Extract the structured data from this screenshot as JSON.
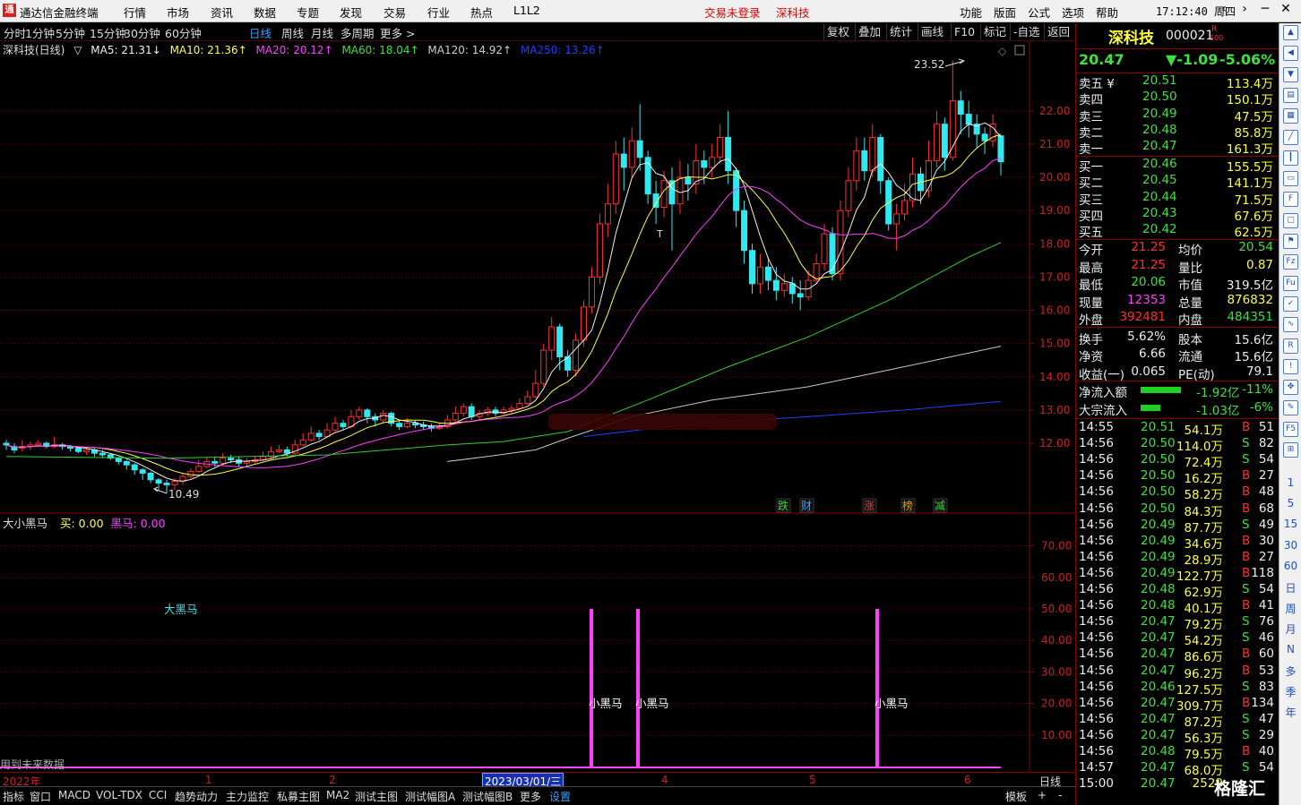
{
  "app": {
    "title": "通达信金融终端",
    "logo": "通"
  },
  "menu": {
    "items": [
      "行情",
      "市场",
      "资讯",
      "数据",
      "专题",
      "发现",
      "交易",
      "行业",
      "热点",
      "L1L2"
    ],
    "status_login": "交易未登录",
    "stock_name": "深科技",
    "right_items": [
      "功能",
      "版面",
      "公式",
      "选项",
      "帮助"
    ],
    "time": "17:12:40",
    "weekday": "周四"
  },
  "period_tabs": [
    "分时",
    "1分钟",
    "5分钟",
    "15分钟",
    "30分钟",
    "60分钟",
    "日线",
    "周线",
    "月线",
    "多周期",
    "更多 >"
  ],
  "active_period": "日线",
  "chart_tools": [
    "复权",
    "叠加",
    "统计",
    "画线",
    "F10",
    "标记",
    "-自选",
    "返回"
  ],
  "main_legend": {
    "title": "深科技(日线)",
    "ma5": "MA5: 21.31↓",
    "ma10": "MA10: 21.36↑",
    "ma20": "MA20: 20.12↑",
    "ma60": "MA60: 18.04↑",
    "ma120": "MA120: 14.92↑",
    "ma250": "MA250: 13.26↑"
  },
  "main_axis_ticks": [
    "22.00",
    "21.00",
    "20.00",
    "19.00",
    "18.00",
    "17.00",
    "16.00",
    "15.00",
    "14.00",
    "13.00",
    "12.00"
  ],
  "price_annotations": {
    "high": "23.52",
    "low": "10.49",
    "t_mark": "T"
  },
  "event_markers": [
    {
      "text": "跌",
      "color": "#40d040"
    },
    {
      "text": "财",
      "color": "#3aa0ff"
    },
    {
      "text": "涨",
      "color": "#ff3030"
    },
    {
      "text": "榜",
      "color": "#e0a000"
    },
    {
      "text": "减",
      "color": "#40d040"
    }
  ],
  "sub_legend": {
    "name": "大小黑马",
    "buy": "买: 0.00",
    "heima": "黑马: 0.00"
  },
  "sub_axis_ticks": [
    "70.00",
    "60.00",
    "50.00",
    "40.00",
    "30.00",
    "20.00",
    "10.00"
  ],
  "sub_labels": {
    "big": "大黑马",
    "small": "小黑马",
    "future": "用到未来数据"
  },
  "sub_signals": [
    {
      "label": "小黑马",
      "value": 50
    },
    {
      "label": "小黑马",
      "value": 50
    },
    {
      "label": "小黑马",
      "value": 50
    }
  ],
  "date_axis": {
    "year": "2022年",
    "months": [
      "1",
      "2",
      "4",
      "5",
      "6"
    ],
    "selected": "2023/03/01/三",
    "period": "日线"
  },
  "bottom_tabs": [
    "指标",
    "窗口",
    "MACD",
    "VOL-TDX",
    "CCI",
    "趋势动力",
    "主力监控",
    "私募主图",
    "MA2",
    "测试主图",
    "测试幅图A",
    "测试幅图B",
    "更多",
    "设置"
  ],
  "bottom_right": [
    "模板",
    "+",
    "-"
  ],
  "quote": {
    "name": "深科技",
    "code": "000021",
    "tag_r": "R",
    "tag_500": "500",
    "price": "20.47",
    "change": "▼-1.09",
    "pct": "-5.06%",
    "asks": [
      {
        "label": "卖五 ¥",
        "price": "20.51",
        "vol": "113.4万"
      },
      {
        "label": "卖四",
        "price": "20.50",
        "vol": "150.1万"
      },
      {
        "label": "卖三",
        "price": "20.49",
        "vol": "47.5万"
      },
      {
        "label": "卖二",
        "price": "20.48",
        "vol": "85.8万"
      },
      {
        "label": "卖一",
        "price": "20.47",
        "vol": "161.3万"
      }
    ],
    "bids": [
      {
        "label": "买一",
        "price": "20.46",
        "vol": "155.5万"
      },
      {
        "label": "买二",
        "price": "20.45",
        "vol": "141.1万"
      },
      {
        "label": "买三",
        "price": "20.44",
        "vol": "71.5万"
      },
      {
        "label": "买四",
        "price": "20.43",
        "vol": "67.6万"
      },
      {
        "label": "买五",
        "price": "20.42",
        "vol": "62.5万"
      }
    ],
    "stats": [
      {
        "l1": "今开",
        "v1": "21.25",
        "l2": "均价",
        "v2": "20.54"
      },
      {
        "l1": "最高",
        "v1": "21.25",
        "l2": "量比",
        "v2": "0.87"
      },
      {
        "l1": "最低",
        "v1": "20.06",
        "l2": "市值",
        "v2": "319.5亿"
      },
      {
        "l1": "现量",
        "v1": "12353",
        "l2": "总量",
        "v2": "876832"
      },
      {
        "l1": "外盘",
        "v1": "392481",
        "l2": "内盘",
        "v2": "484351"
      },
      {
        "l1": "换手",
        "v1": "5.62%",
        "l2": "股本",
        "v2": "15.6亿"
      },
      {
        "l1": "净资",
        "v1": "6.66",
        "l2": "流通",
        "v2": "15.6亿"
      },
      {
        "l1": "收益(一)",
        "v1": "0.065",
        "l2": "PE(动)",
        "v2": "79.1"
      }
    ],
    "flows": [
      {
        "label": "净流入额",
        "value": "-1.92亿",
        "pct": "-11%"
      },
      {
        "label": "大宗流入",
        "value": "-1.03亿",
        "pct": "-6%"
      }
    ],
    "ticks": [
      {
        "t": "14:55",
        "p": "20.51",
        "v": "54.1万",
        "s": "B",
        "n": "51"
      },
      {
        "t": "14:56",
        "p": "20.50",
        "v": "114.0万",
        "s": "S",
        "n": "82"
      },
      {
        "t": "14:56",
        "p": "20.50",
        "v": "72.4万",
        "s": "S",
        "n": "54"
      },
      {
        "t": "14:56",
        "p": "20.50",
        "v": "16.2万",
        "s": "B",
        "n": "27"
      },
      {
        "t": "14:56",
        "p": "20.50",
        "v": "58.2万",
        "s": "B",
        "n": "48"
      },
      {
        "t": "14:56",
        "p": "20.50",
        "v": "84.3万",
        "s": "B",
        "n": "68"
      },
      {
        "t": "14:56",
        "p": "20.49",
        "v": "87.7万",
        "s": "S",
        "n": "49"
      },
      {
        "t": "14:56",
        "p": "20.49",
        "v": "34.6万",
        "s": "B",
        "n": "30"
      },
      {
        "t": "14:56",
        "p": "20.49",
        "v": "28.9万",
        "s": "B",
        "n": "27"
      },
      {
        "t": "14:56",
        "p": "20.49",
        "v": "122.7万",
        "s": "B",
        "n": "118"
      },
      {
        "t": "14:56",
        "p": "20.48",
        "v": "62.9万",
        "s": "S",
        "n": "54"
      },
      {
        "t": "14:56",
        "p": "20.48",
        "v": "40.1万",
        "s": "B",
        "n": "41"
      },
      {
        "t": "14:56",
        "p": "20.47",
        "v": "79.2万",
        "s": "S",
        "n": "76"
      },
      {
        "t": "14:56",
        "p": "20.47",
        "v": "54.2万",
        "s": "S",
        "n": "46"
      },
      {
        "t": "14:56",
        "p": "20.47",
        "v": "86.6万",
        "s": "B",
        "n": "60"
      },
      {
        "t": "14:56",
        "p": "20.47",
        "v": "96.2万",
        "s": "B",
        "n": "53"
      },
      {
        "t": "14:56",
        "p": "20.46",
        "v": "127.5万",
        "s": "S",
        "n": "83"
      },
      {
        "t": "14:56",
        "p": "20.47",
        "v": "309.7万",
        "s": "B",
        "n": "134"
      },
      {
        "t": "14:56",
        "p": "20.47",
        "v": "87.2万",
        "s": "S",
        "n": "47"
      },
      {
        "t": "14:56",
        "p": "20.47",
        "v": "56.3万",
        "s": "S",
        "n": "29"
      },
      {
        "t": "14:56",
        "p": "20.48",
        "v": "79.5万",
        "s": "B",
        "n": "40"
      },
      {
        "t": "14:57",
        "p": "20.47",
        "v": "68.0万",
        "s": "S",
        "n": "54"
      },
      {
        "t": "15:00",
        "p": "20.47",
        "v": "2529",
        "s": "",
        "n": ""
      }
    ]
  },
  "side_tools": {
    "icons": [
      "up-icon",
      "left-icon",
      "down-icon",
      "chart-icon",
      "grid-icon",
      "line-icon",
      "candle-icon",
      "window-icon",
      "f10-icon",
      "doc-icon",
      "flag-icon",
      "fz-icon",
      "fu-icon",
      "ok-icon",
      "wave-icon",
      "rsi-icon",
      "alert-icon",
      "move-icon",
      "pen-icon",
      "f5-icon",
      "split-icon"
    ],
    "periods": [
      "1",
      "5",
      "15",
      "30",
      "60",
      "日",
      "周",
      "月",
      "N",
      "多",
      "季",
      "年"
    ]
  },
  "watermark": "格隆汇"
}
